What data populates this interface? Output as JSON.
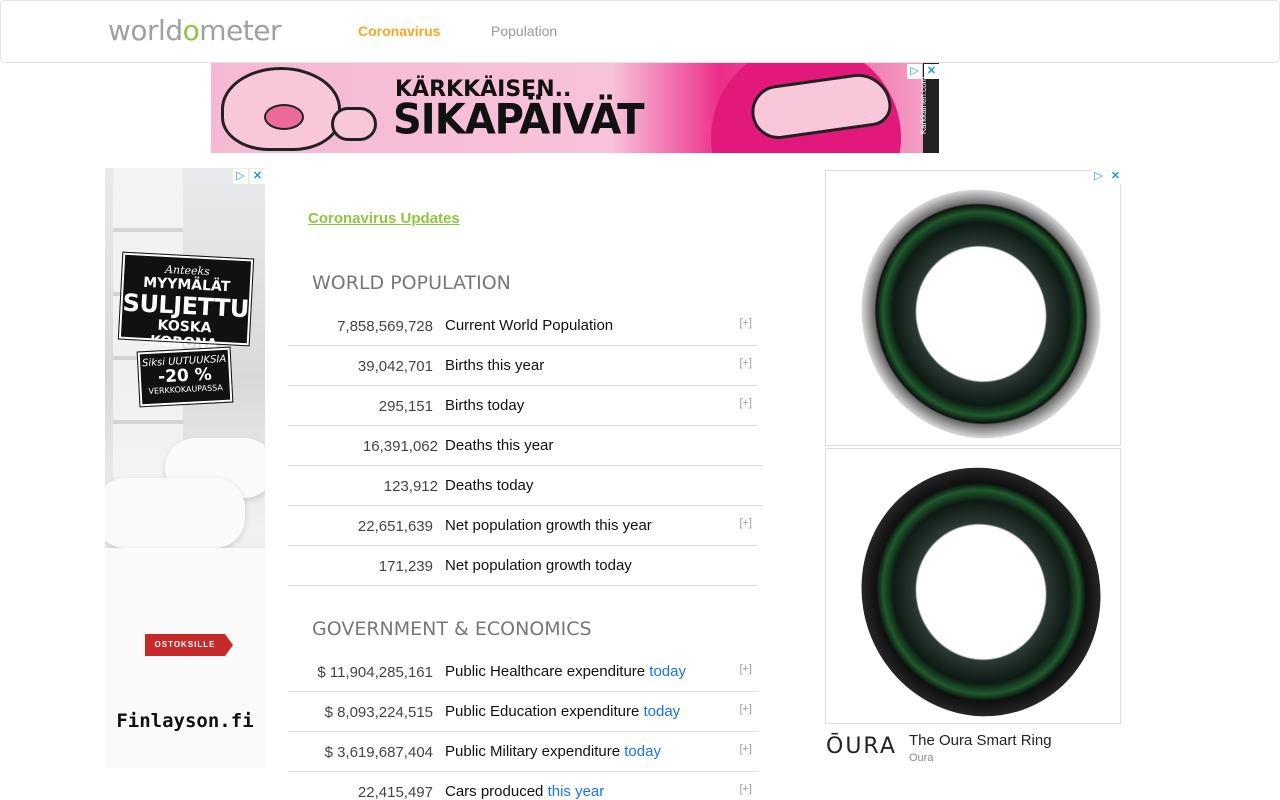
{
  "header": {
    "logo_text_pre": "world",
    "logo_text_o": "o",
    "logo_text_post": "meter",
    "nav": [
      {
        "label": "Coronavirus",
        "color": "#f5a623"
      },
      {
        "label": "Population",
        "color": "#999999"
      }
    ]
  },
  "top_ad": {
    "line1": "KÄRKKÄISEN..",
    "line2": "SIKAPÄIVÄT",
    "side_text": "Karkkainen.com"
  },
  "left_ad": {
    "sign1_small": "Anteeks",
    "sign1_top": "MYYMÄLÄT",
    "sign1_big": "SULJETTU",
    "sign1_bottom": "KOSKA KORONA",
    "sign2_a": "Siksi UUTUUKSIA",
    "sign2_b": "-20 %",
    "sign2_c": "VERKKOKAUPASSA",
    "cta": "OSTOKSILLE",
    "brand": "Finlayson.fi"
  },
  "main": {
    "updates_link": "Coronavirus Updates",
    "world_population": {
      "title": "WORLD POPULATION",
      "rows": [
        {
          "num": "7,858,569,728",
          "label": "Current World Population",
          "link": "",
          "plus": "[+]"
        },
        {
          "num": "39,042,701",
          "label": "Births this year",
          "link": "",
          "plus": "[+]"
        },
        {
          "num": "295,151",
          "label": "Births today",
          "link": "",
          "plus": "[+]"
        },
        {
          "num": "16,391,062",
          "label": "Deaths this year",
          "link": "",
          "plus": ""
        },
        {
          "num": "123,912",
          "label": "Deaths today",
          "link": "",
          "plus": ""
        },
        {
          "num": "22,651,639",
          "label": "Net population growth this year",
          "link": "",
          "plus": "[+]"
        },
        {
          "num": "171,239",
          "label": "Net population growth today",
          "link": "",
          "plus": ""
        }
      ]
    },
    "government": {
      "title": "GOVERNMENT & ECONOMICS",
      "rows": [
        {
          "num": "$ 11,904,285,161",
          "label": "Public Healthcare expenditure ",
          "link": "today",
          "plus": "[+]"
        },
        {
          "num": "$ 8,093,224,515",
          "label": "Public Education expenditure ",
          "link": "today",
          "plus": "[+]"
        },
        {
          "num": "$ 3,619,687,404",
          "label": "Public Military expenditure ",
          "link": "today",
          "plus": "[+]"
        },
        {
          "num": "22,415,497",
          "label": "Cars produced ",
          "link": "this year",
          "plus": "[+]"
        }
      ]
    }
  },
  "right_ad": {
    "brandmark": "ŌURA",
    "title": "The Oura Smart Ring",
    "advertiser": "Oura"
  },
  "adchoices": {
    "info": "▷",
    "close": "✕"
  }
}
